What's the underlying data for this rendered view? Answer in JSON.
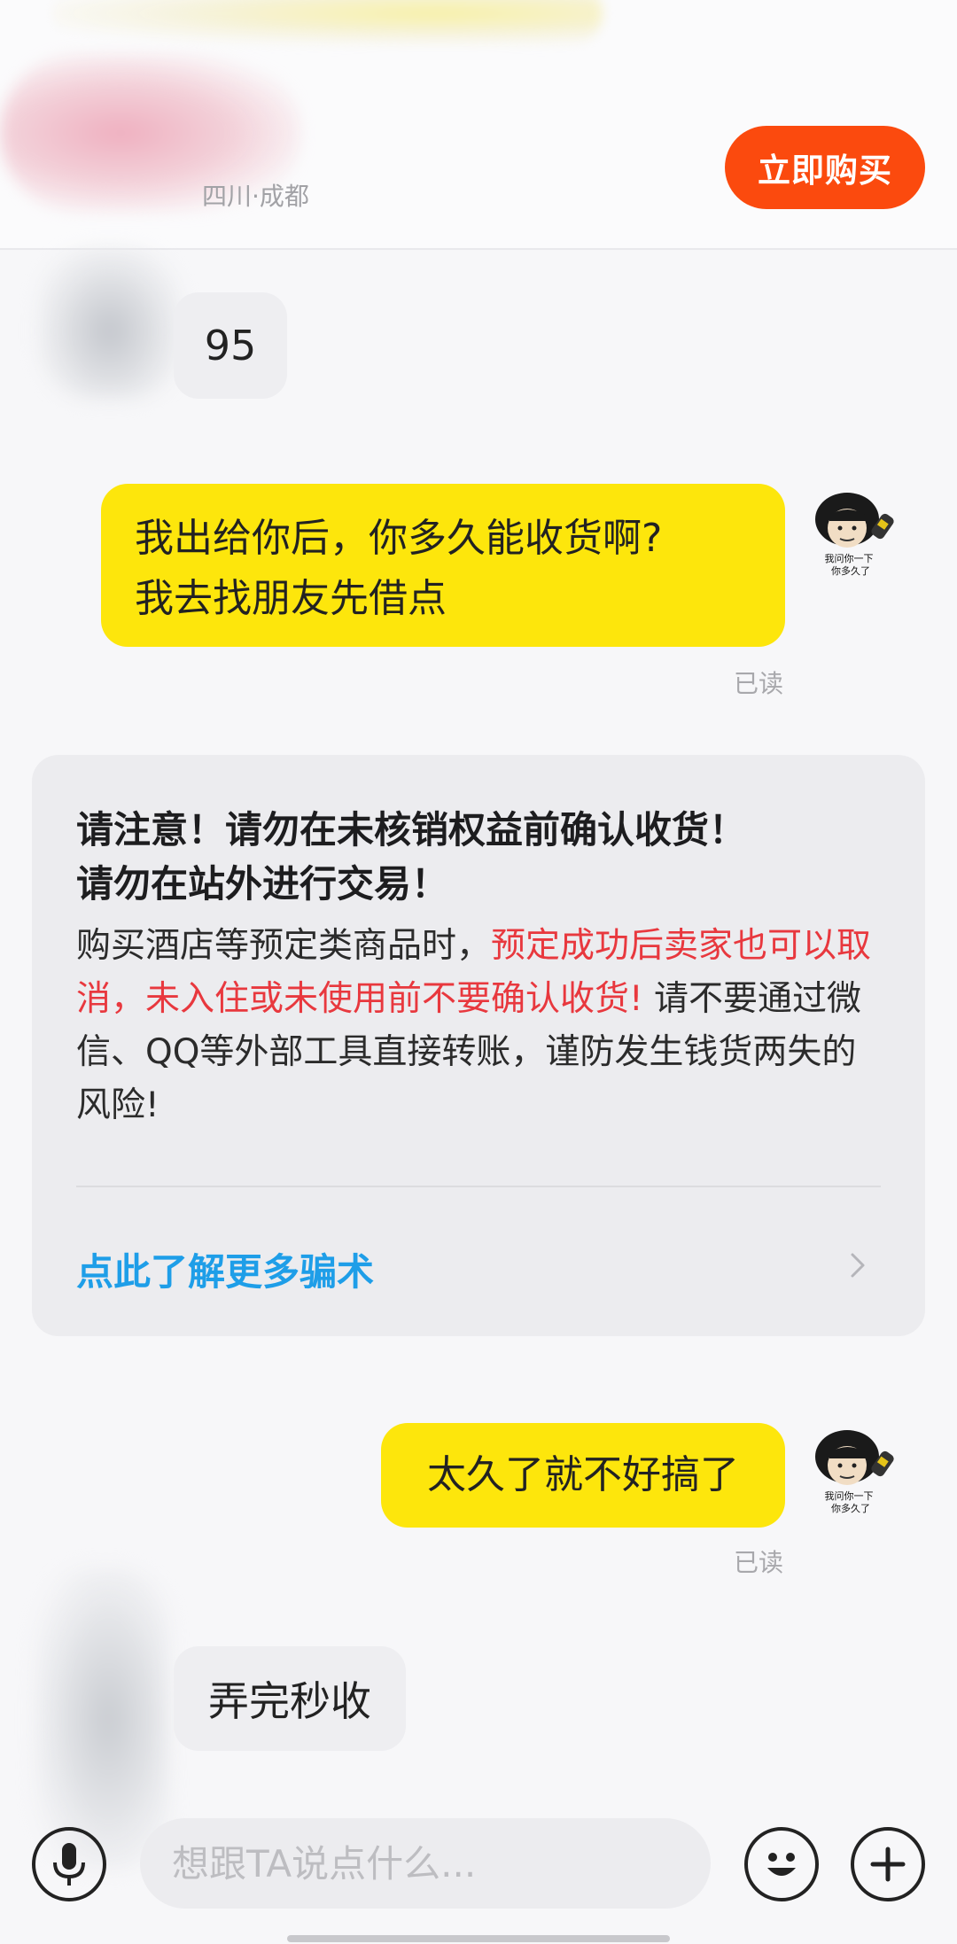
{
  "header": {
    "location": "四川·成都",
    "buy_button": "立即购买"
  },
  "messages": [
    {
      "side": "in",
      "text": "95"
    },
    {
      "side": "out",
      "lines": [
        "我出给你后，你多久能收货啊?",
        "我去找朋友先借点"
      ],
      "status": "已读",
      "sticker_caption": [
        "我问你一下",
        "你多久了"
      ]
    },
    {
      "side": "out",
      "text": "太久了就不好搞了",
      "status": "已读",
      "sticker_caption": [
        "我问你一下",
        "你多久了"
      ]
    },
    {
      "side": "in",
      "text": "弄完秒收"
    }
  ],
  "notice": {
    "title_line1": "请注意！请勿在未核销权益前确认收货！",
    "title_line2": "请勿在站外进行交易！",
    "body_prefix": "购买酒店等预定类商品时，",
    "body_red": "预定成功后卖家也可以取消，未入住或未使用前不要确认收货!",
    "body_suffix": " 请不要通过微信、QQ等外部工具直接转账，谨防发生钱货两失的风险!",
    "link": "点此了解更多骗术"
  },
  "input_bar": {
    "placeholder": "想跟TA说点什么...",
    "icons": [
      "microphone-icon",
      "emoji-icon",
      "plus-icon"
    ]
  },
  "colors": {
    "buy_button": "#fb4a0e",
    "outgoing_bubble": "#fde60c",
    "warning_red": "#e8383e",
    "link_blue": "#1e9ee8"
  }
}
